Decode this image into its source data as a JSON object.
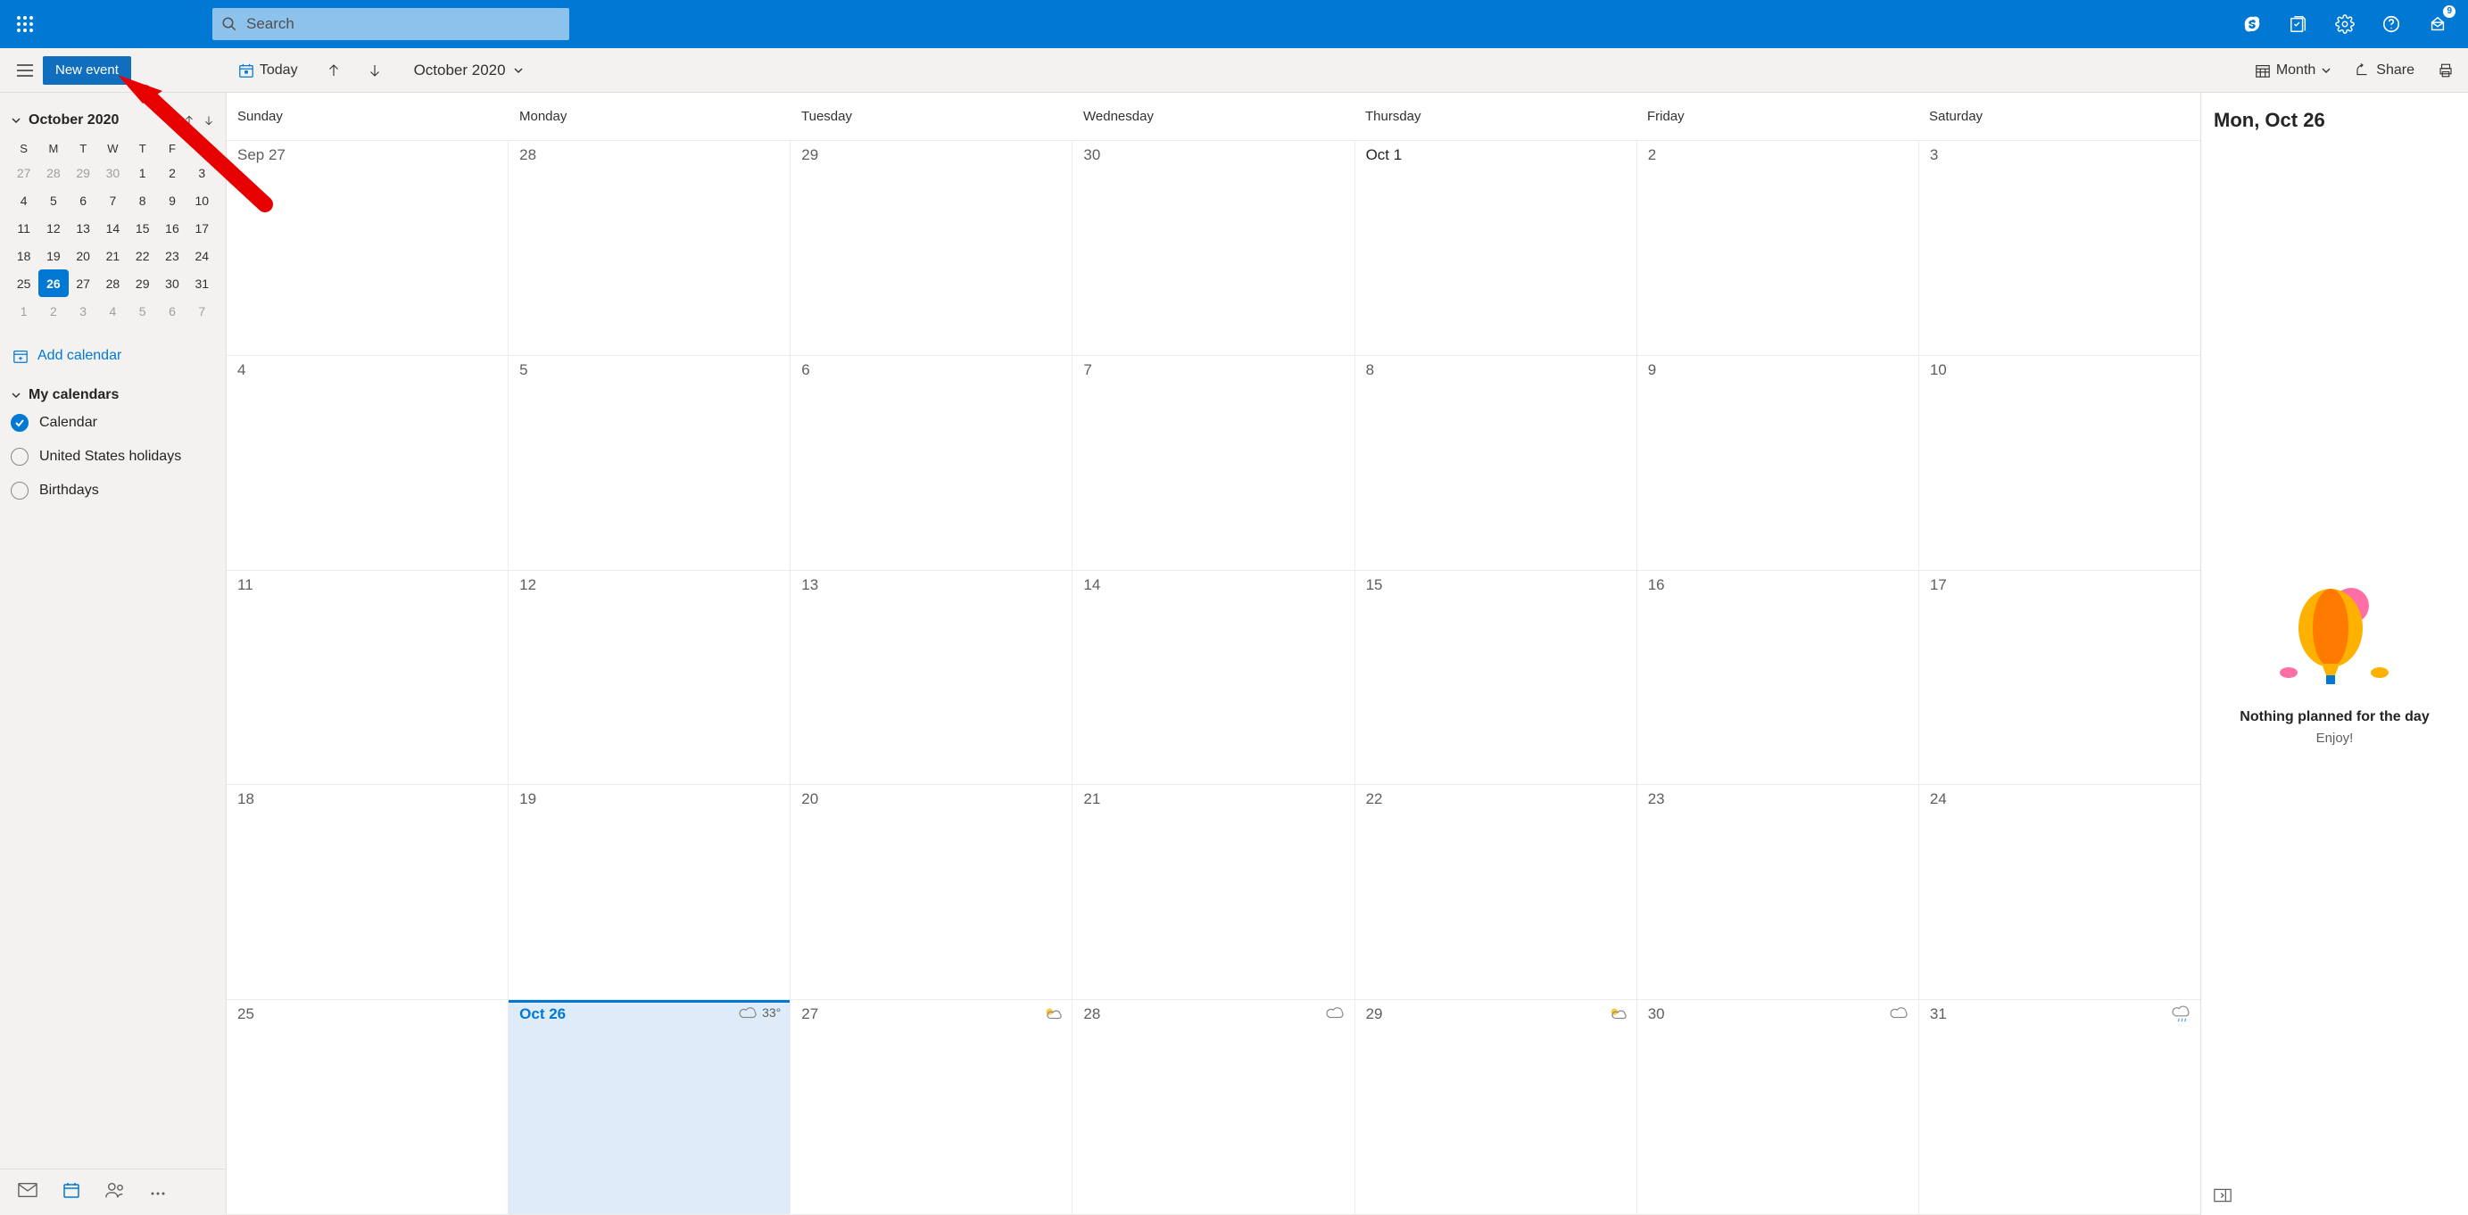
{
  "topbar": {
    "search_placeholder": "Search",
    "badge": "9"
  },
  "commandbar": {
    "new_event": "New event",
    "today": "Today",
    "month_year": "October 2020",
    "view": "Month",
    "share": "Share"
  },
  "mini": {
    "label": "October 2020",
    "weekday_letters": [
      "S",
      "M",
      "T",
      "W",
      "T",
      "F",
      "S"
    ],
    "rows": [
      [
        {
          "n": "27",
          "f": 1
        },
        {
          "n": "28",
          "f": 1
        },
        {
          "n": "29",
          "f": 1
        },
        {
          "n": "30",
          "f": 1
        },
        {
          "n": "1"
        },
        {
          "n": "2"
        },
        {
          "n": "3"
        }
      ],
      [
        {
          "n": "4"
        },
        {
          "n": "5"
        },
        {
          "n": "6"
        },
        {
          "n": "7"
        },
        {
          "n": "8"
        },
        {
          "n": "9"
        },
        {
          "n": "10"
        }
      ],
      [
        {
          "n": "11"
        },
        {
          "n": "12"
        },
        {
          "n": "13"
        },
        {
          "n": "14"
        },
        {
          "n": "15"
        },
        {
          "n": "16"
        },
        {
          "n": "17"
        }
      ],
      [
        {
          "n": "18"
        },
        {
          "n": "19"
        },
        {
          "n": "20"
        },
        {
          "n": "21"
        },
        {
          "n": "22"
        },
        {
          "n": "23"
        },
        {
          "n": "24"
        }
      ],
      [
        {
          "n": "25"
        },
        {
          "n": "26",
          "t": 1
        },
        {
          "n": "27"
        },
        {
          "n": "28"
        },
        {
          "n": "29"
        },
        {
          "n": "30"
        },
        {
          "n": "31"
        }
      ],
      [
        {
          "n": "1",
          "f": 1
        },
        {
          "n": "2",
          "f": 1
        },
        {
          "n": "3",
          "f": 1
        },
        {
          "n": "4",
          "f": 1
        },
        {
          "n": "5",
          "f": 1
        },
        {
          "n": "6",
          "f": 1
        },
        {
          "n": "7",
          "f": 1
        }
      ]
    ]
  },
  "add_calendar": "Add calendar",
  "my_calendars_label": "My calendars",
  "calendars": [
    {
      "name": "Calendar",
      "checked": true
    },
    {
      "name": "United States holidays",
      "checked": false
    },
    {
      "name": "Birthdays",
      "checked": false
    }
  ],
  "weekdays": [
    "Sunday",
    "Monday",
    "Tuesday",
    "Wednesday",
    "Thursday",
    "Friday",
    "Saturday"
  ],
  "grid": [
    [
      {
        "l": "Sep 27"
      },
      {
        "l": "28"
      },
      {
        "l": "29"
      },
      {
        "l": "30"
      },
      {
        "l": "Oct 1",
        "emph": 1
      },
      {
        "l": "2"
      },
      {
        "l": "3"
      }
    ],
    [
      {
        "l": "4"
      },
      {
        "l": "5"
      },
      {
        "l": "6"
      },
      {
        "l": "7"
      },
      {
        "l": "8"
      },
      {
        "l": "9"
      },
      {
        "l": "10"
      }
    ],
    [
      {
        "l": "11"
      },
      {
        "l": "12"
      },
      {
        "l": "13"
      },
      {
        "l": "14"
      },
      {
        "l": "15"
      },
      {
        "l": "16"
      },
      {
        "l": "17"
      }
    ],
    [
      {
        "l": "18"
      },
      {
        "l": "19"
      },
      {
        "l": "20"
      },
      {
        "l": "21"
      },
      {
        "l": "22"
      },
      {
        "l": "23"
      },
      {
        "l": "24"
      }
    ],
    [
      {
        "l": "25"
      },
      {
        "l": "Oct 26",
        "today": 1,
        "w": {
          "icon": "cloud",
          "t": "33°"
        }
      },
      {
        "l": "27",
        "w": {
          "icon": "partly"
        }
      },
      {
        "l": "28",
        "w": {
          "icon": "cloud"
        }
      },
      {
        "l": "29",
        "w": {
          "icon": "partly"
        }
      },
      {
        "l": "30",
        "w": {
          "icon": "cloud"
        }
      },
      {
        "l": "31",
        "w": {
          "icon": "rain"
        }
      }
    ]
  ],
  "agenda": {
    "title": "Mon, Oct 26",
    "empty1": "Nothing planned for the day",
    "empty2": "Enjoy!"
  }
}
